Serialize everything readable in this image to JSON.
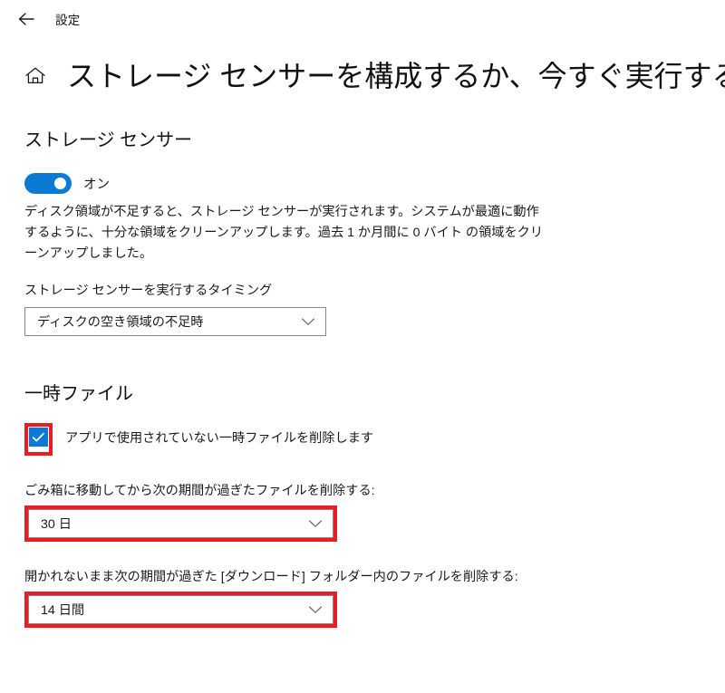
{
  "topbar": {
    "back_icon": "back-arrow-icon",
    "settings_label": "設定"
  },
  "header": {
    "home_icon": "home-icon",
    "title": "ストレージ センサーを構成するか、今すぐ実行する"
  },
  "storage_sense": {
    "heading": "ストレージ センサー",
    "toggle": {
      "state_label": "オン",
      "on": true,
      "color": "#0a7bd4"
    },
    "description": "ディスク領域が不足すると、ストレージ センサーが実行されます。システムが最適に動作するように、十分な領域をクリーンアップします。過去 1 か月間に 0 バイト の領域をクリーンアップしました。",
    "schedule_label": "ストレージ センサーを実行するタイミング",
    "schedule_dropdown": {
      "value": "ディスクの空き領域の不足時",
      "chevron_icon": "chevron-down-icon"
    }
  },
  "temp_files": {
    "heading": "一時ファイル",
    "checkbox": {
      "label": "アプリで使用されていない一時ファイルを削除します",
      "checked": true,
      "color": "#0a7bd4",
      "check_icon": "checkmark-icon",
      "annotated": true
    },
    "recycle_bin": {
      "label": "ごみ箱に移動してから次の期間が過ぎたファイルを削除する:",
      "dropdown": {
        "value": "30 日",
        "chevron_icon": "chevron-down-icon"
      },
      "annotated": true
    },
    "downloads": {
      "label": "開かれないまま次の期間が過ぎた [ダウンロード] フォルダー内のファイルを削除する:",
      "dropdown": {
        "value": "14 日間",
        "chevron_icon": "chevron-down-icon"
      },
      "annotated": true
    }
  },
  "annotation": {
    "color": "#ec1c24"
  }
}
